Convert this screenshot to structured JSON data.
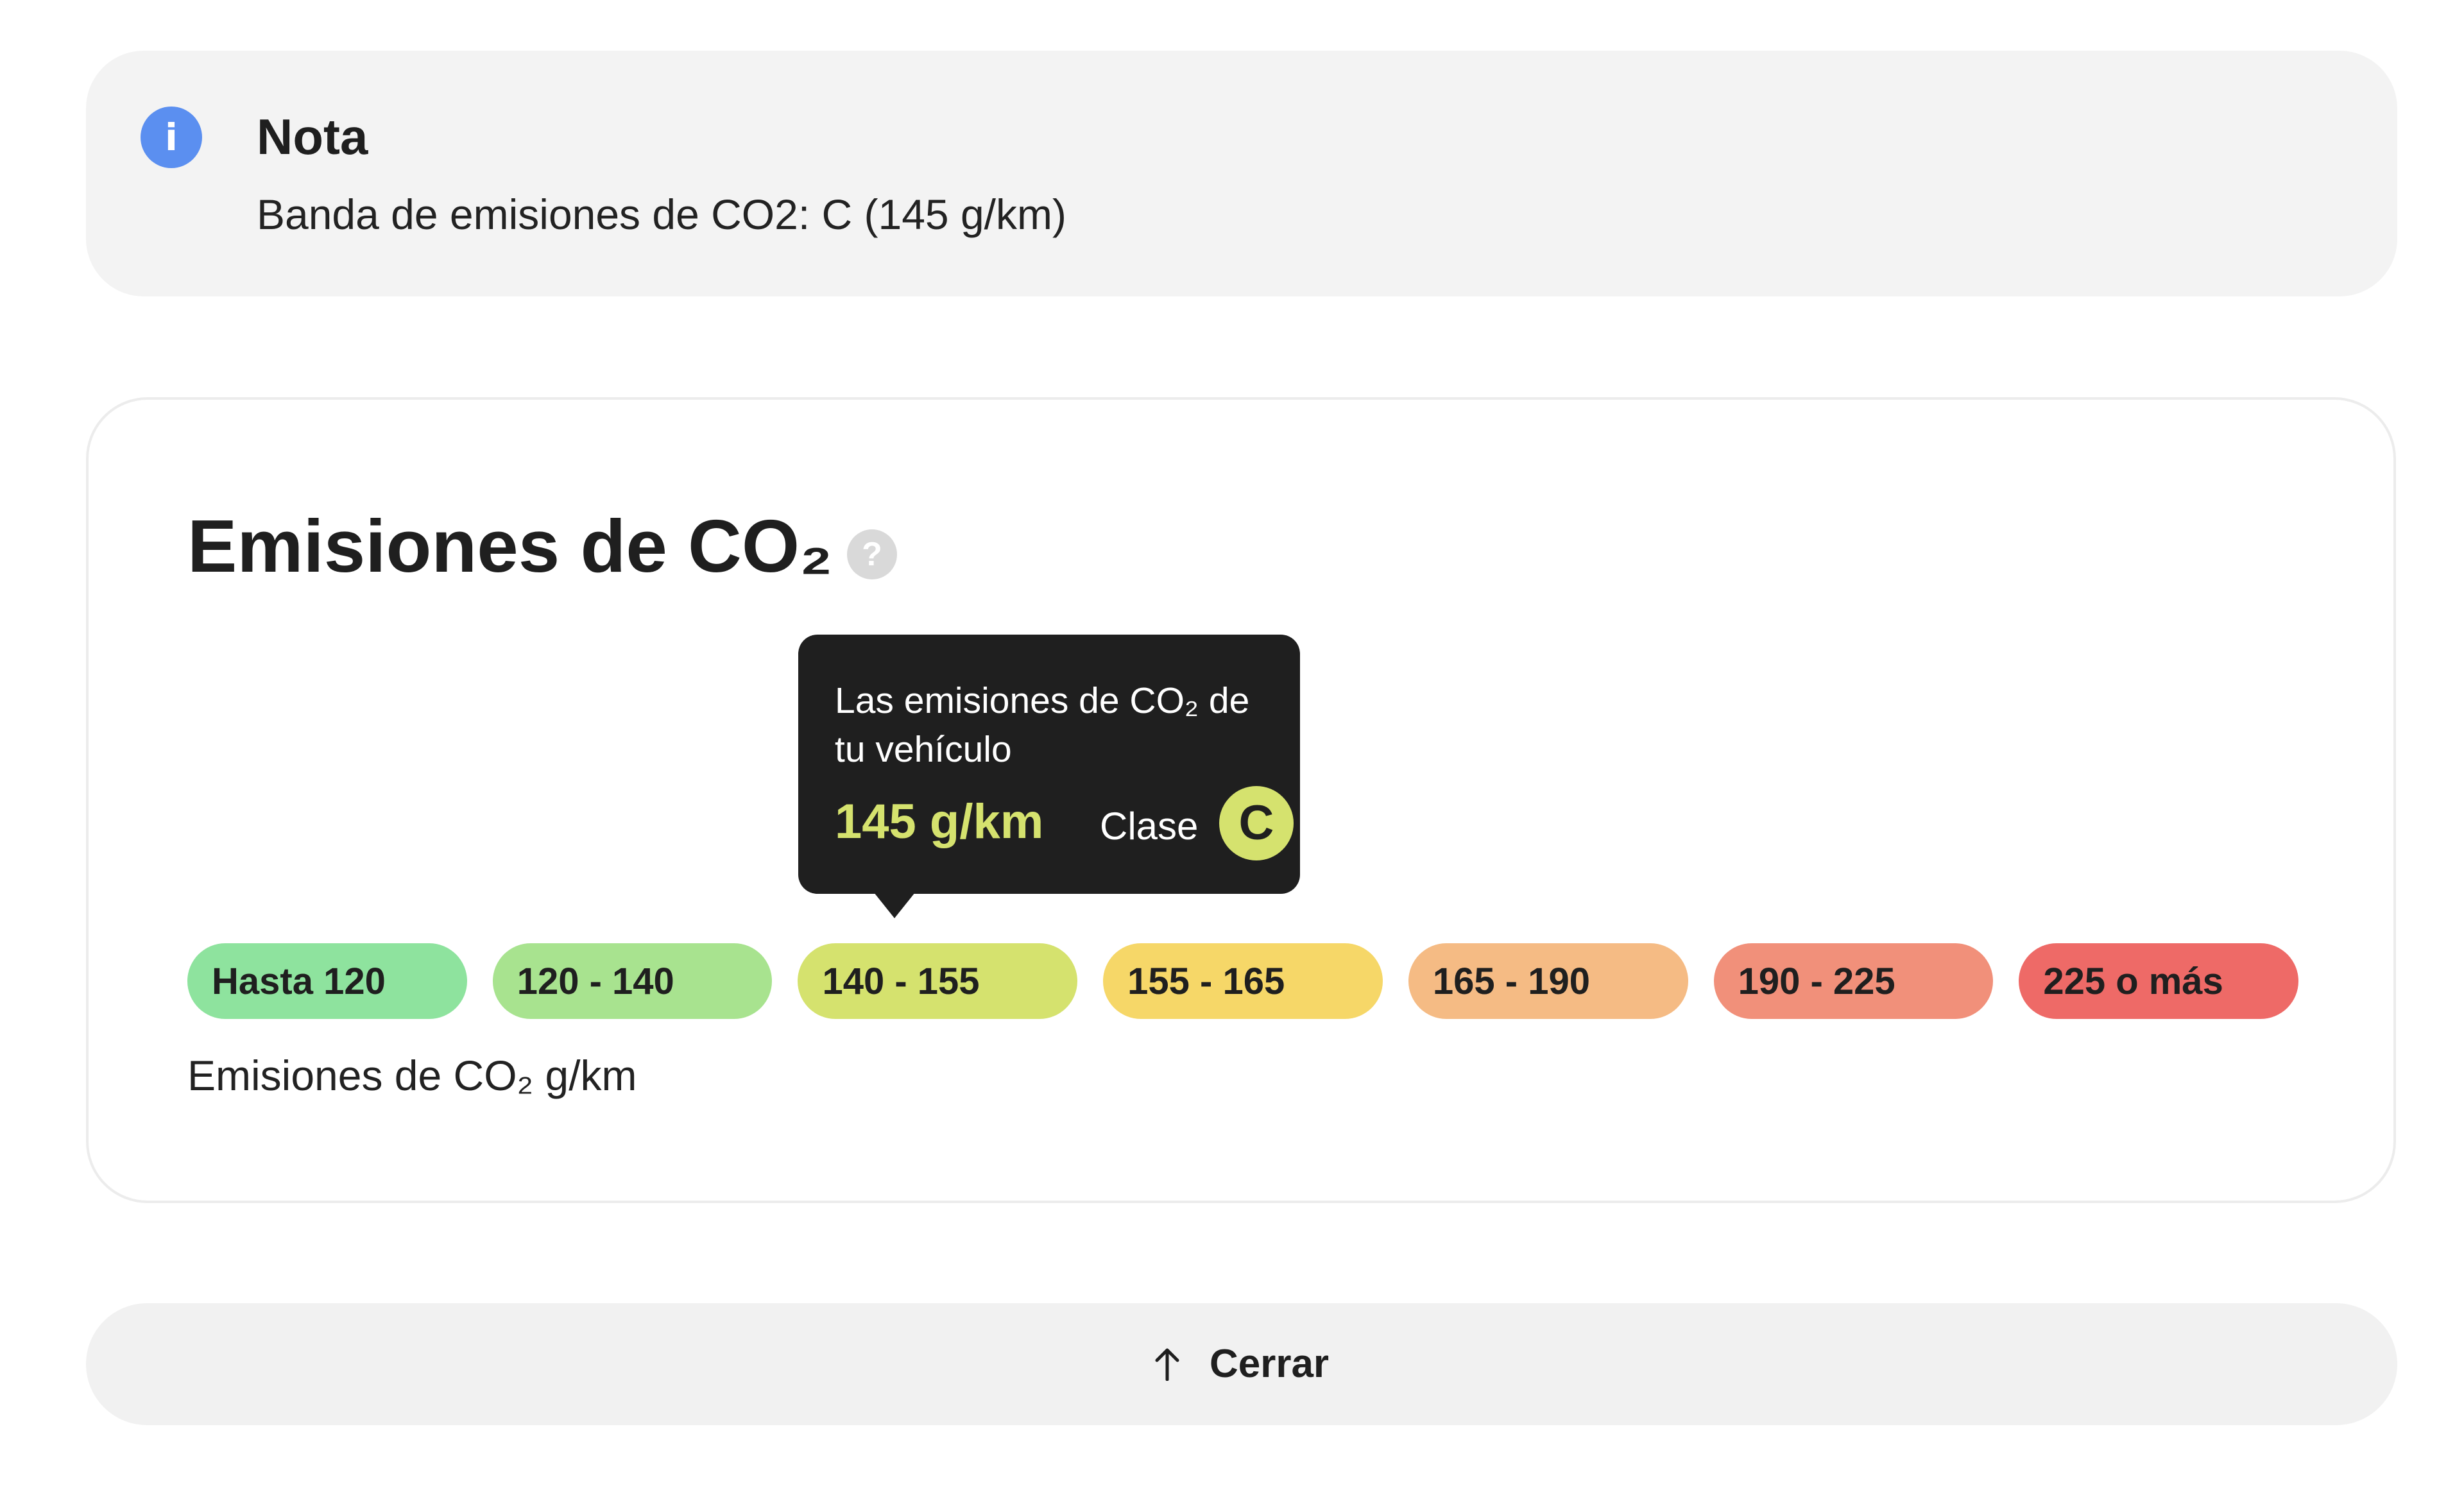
{
  "note": {
    "icon": "info-icon",
    "icon_glyph": "i",
    "title": "Nota",
    "text": "Banda de emisiones de CO2: C (145 g/km)"
  },
  "emissions": {
    "title": "Emisiones de CO₂",
    "help_icon": "question-icon",
    "help_glyph": "?",
    "tooltip": {
      "label": "Las emisiones de CO₂ de tu vehículo",
      "value": "145 g/km",
      "class_label": "Clase",
      "class_value": "C"
    },
    "bands": [
      {
        "label": "Hasta 120",
        "color": "#8ee39e"
      },
      {
        "label": "120 - 140",
        "color": "#a8e38f"
      },
      {
        "label": "140 - 155",
        "color": "#d5e26e"
      },
      {
        "label": "155 - 165",
        "color": "#f6d768"
      },
      {
        "label": "165 - 190",
        "color": "#f5bb84"
      },
      {
        "label": "190 - 225",
        "color": "#f1907a"
      },
      {
        "label": "225 o más",
        "color": "#ee6a67"
      }
    ],
    "selected_band": 2,
    "axis_label": "Emisiones de CO₂ g/km"
  },
  "close": {
    "icon": "arrow-up-icon",
    "label": "Cerrar"
  },
  "colors": {
    "info_blue": "#5b8ff0",
    "tooltip_bg": "#1f1f1f",
    "tooltip_accent": "#d5e26e"
  }
}
